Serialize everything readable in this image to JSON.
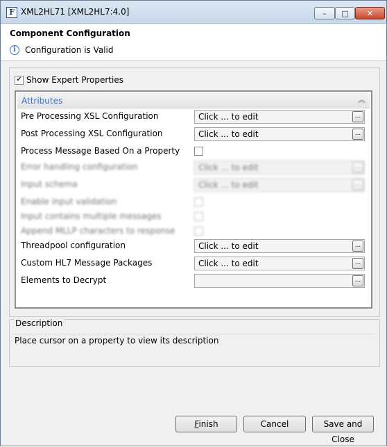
{
  "window": {
    "title": "XML2HL71 [XML2HL7:4.0]",
    "controls": {
      "minimize": "–",
      "maximize": "□",
      "close": "✕"
    }
  },
  "header": {
    "title": "Component Configuration",
    "status": "Configuration is Valid"
  },
  "expert": {
    "label": "Show Expert Properties",
    "checked": true
  },
  "attributes": {
    "title": "Attributes",
    "properties": [
      {
        "label": "Pre Processing XSL Configuration",
        "type": "edit",
        "value": "Click ... to edit"
      },
      {
        "label": "Post Processing XSL Configuration",
        "type": "edit",
        "value": "Click ... to edit"
      },
      {
        "label": "Process Message Based On a Property",
        "type": "checkbox",
        "checked": false
      },
      {
        "label": "Error handling configuration",
        "type": "edit",
        "value": "Click ... to edit",
        "blurred": true
      },
      {
        "label": "Input schema",
        "type": "edit",
        "value": "Click ... to edit",
        "blurred": true
      },
      {
        "label": "Enable input validation",
        "type": "checkbox",
        "blurred": true
      },
      {
        "label": "Input contains multiple messages",
        "type": "checkbox",
        "blurred": true
      },
      {
        "label": "Append MLLP characters to response",
        "type": "checkbox",
        "blurred": true
      },
      {
        "label": "Threadpool configuration",
        "type": "edit",
        "value": "Click ... to edit"
      },
      {
        "label": "Custom HL7 Message Packages",
        "type": "edit",
        "value": "Click ... to edit"
      },
      {
        "label": "Elements to Decrypt",
        "type": "edit",
        "value": ""
      }
    ],
    "ellipsis": "..."
  },
  "description": {
    "title": "Description",
    "text": "Place cursor on a property to view its description"
  },
  "buttons": {
    "finish": "Finish",
    "cancel": "Cancel",
    "save_close": "Save and Close"
  }
}
